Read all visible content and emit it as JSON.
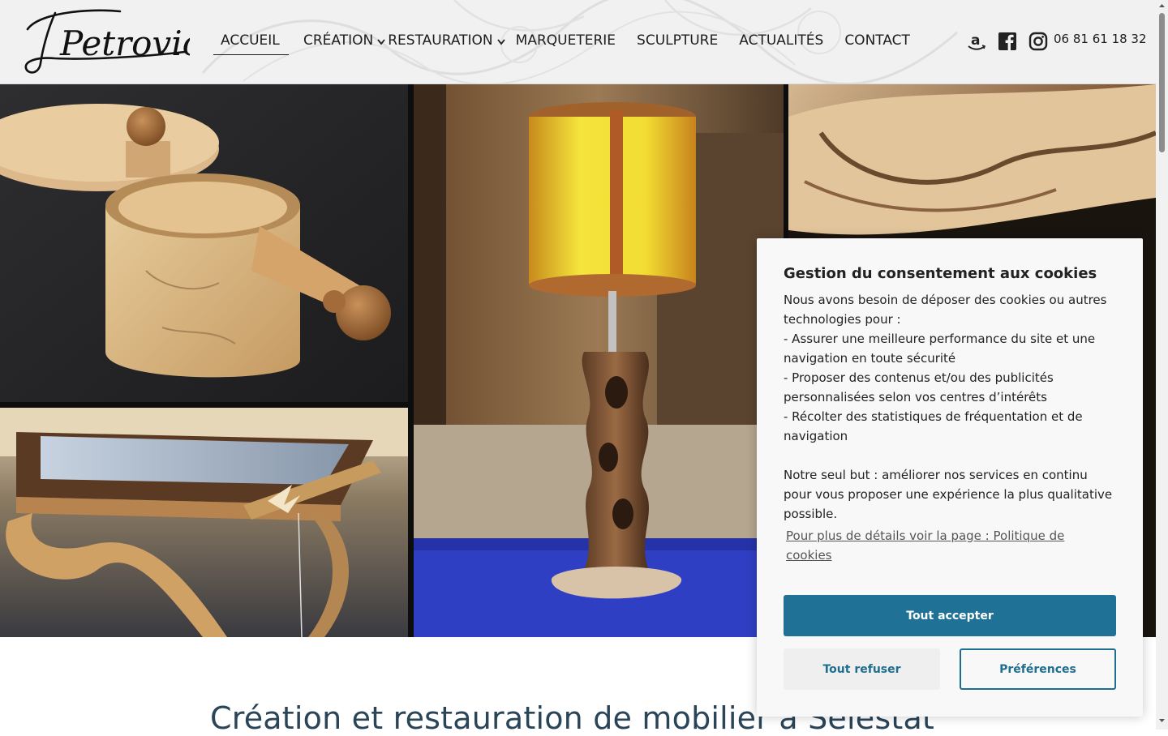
{
  "header": {
    "logo_text": "Petrovic",
    "nav": [
      {
        "label": "ACCUEIL",
        "active": true,
        "has_dropdown": false
      },
      {
        "label": "CRÉATION",
        "active": false,
        "has_dropdown": true
      },
      {
        "label": "RESTAURATION",
        "active": false,
        "has_dropdown": true
      },
      {
        "label": "MARQUETERIE",
        "active": false,
        "has_dropdown": false
      },
      {
        "label": "SCULPTURE",
        "active": false,
        "has_dropdown": false
      },
      {
        "label": "ACTUALITÉS",
        "active": false,
        "has_dropdown": false
      },
      {
        "label": "CONTACT",
        "active": false,
        "has_dropdown": false
      }
    ],
    "social_icons": [
      "amazon-icon",
      "facebook-icon",
      "instagram-icon"
    ],
    "phone": "06 81 61 18 32"
  },
  "hero": {
    "photos": [
      "wooden-lidded-box",
      "carved-wood-lamp",
      "carved-wood-detail",
      "marquetry-table"
    ]
  },
  "main": {
    "headline": "Création et restauration de mobilier à Sélestat"
  },
  "cookie_banner": {
    "title": "Gestion du consentement aux cookies",
    "body_lines": [
      "Nous avons besoin de déposer des cookies ou autres technologies pour :",
      "- Assurer une meilleure performance du site et une navigation en toute sécurité",
      "- Proposer des contenus et/ou des publicités personnalisées selon vos centres d’intérêts",
      "- Récolter des statistiques de fréquentation et de navigation",
      "",
      "Notre seul but : améliorer nos services en continu pour vous proposer une expérience la plus qualitative possible."
    ],
    "policy_link": "Pour plus de détails voir la page : Politique de cookies",
    "accept_label": "Tout accepter",
    "refuse_label": "Tout refuser",
    "preferences_label": "Préférences"
  },
  "colors": {
    "accent": "#1f7296",
    "headline": "#2a4458",
    "header_bg": "#f1f1f1"
  }
}
